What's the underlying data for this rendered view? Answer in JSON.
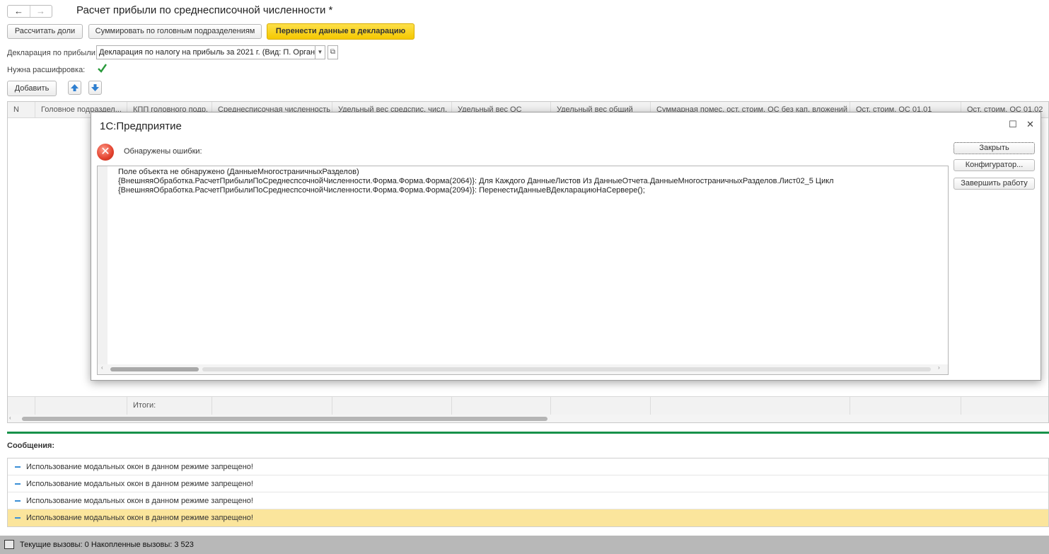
{
  "header": {
    "back_icon": "←",
    "forward_icon": "→",
    "title": "Расчет прибыли по среднесписочной численности *"
  },
  "toolbar": {
    "calc_shares": "Рассчитать доли",
    "sum_by_head": "Суммировать по головным подразделениям",
    "transfer": "Перенести данные в декларацию"
  },
  "form": {
    "declaration_label": "Декларация по прибыли:",
    "declaration_value": "Декларация по налогу на прибыль за 2021 г. (Вид: П. Орган",
    "decoding_label": "Нужна расшифровка:",
    "decoding_checked": true,
    "add_button": "Добавить"
  },
  "table": {
    "columns": [
      "N",
      "Головное подраздел...",
      "КПП головного подр.",
      "Среднесписочная численность",
      "Удельный вес средспис. числ.",
      "Удельный вес ОС",
      "Удельный вес общий",
      "Суммарная помес. ост. стоим. ОС без кап. вложений",
      "Ост. стоим. ОС 01.01",
      "Ост. стоим. ОС 01.02"
    ],
    "totals_label": "Итоги:"
  },
  "dialog": {
    "title": "1С:Предприятие",
    "error_heading": "Обнаружены ошибки:",
    "lines": [
      "Поле объекта не обнаружено (ДанныеМногостраничныхРазделов)",
      "{ВнешняяОбработка.РасчетПрибылиПоСреднеспсочнойЧисленности.Форма.Форма.Форма(2064)}:  Для Каждого ДанныеЛистов Из ДанныеОтчета.ДанныеМногостраничныхРазделов.Лист02_5 Цикл",
      "{ВнешняяОбработка.РасчетПрибылиПоСреднеспсочнойЧисленности.Форма.Форма.Форма(2094)}:  ПеренестиДанныеВДекларациюНаСервере();"
    ],
    "btn_close": "Закрыть",
    "btn_configurator": "Конфигуратор...",
    "btn_exit": "Завершить работу"
  },
  "messages": {
    "title": "Сообщения:",
    "items": [
      "Использование модальных окон в данном режиме запрещено!",
      "Использование модальных окон в данном режиме запрещено!",
      "Использование модальных окон в данном режиме запрещено!",
      "Использование модальных окон в данном режиме запрещено!"
    ]
  },
  "statusbar": {
    "text": "Текущие вызовы: 0   Накопленные вызовы: 3 523"
  },
  "colors": {
    "accent_yellow": "#f5c800",
    "messages_divider": "#17924a",
    "selected_message": "#fbe59c",
    "error_icon": "#e2412d"
  }
}
